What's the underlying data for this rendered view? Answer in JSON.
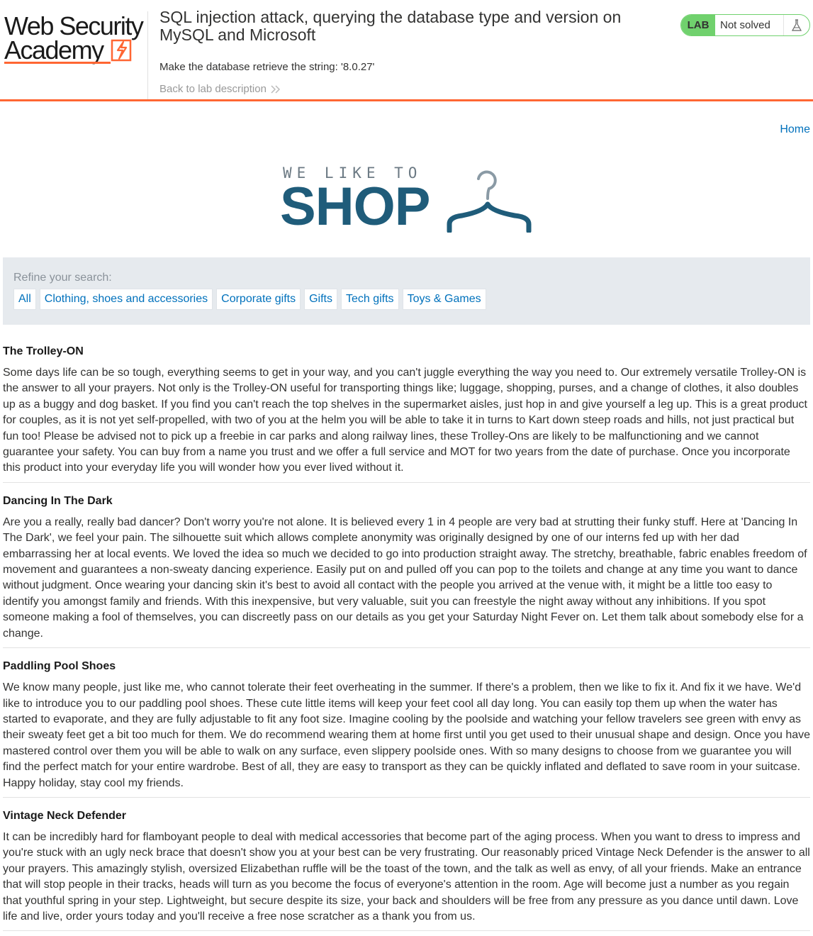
{
  "academy": {
    "logo_line1": "Web Security",
    "logo_line2": "Academy",
    "lab_title": "SQL injection attack, querying the database type and version on MySQL and Microsoft",
    "goal": "Make the database retrieve the string: '8.0.27'",
    "back_link": "Back to lab description",
    "lab_badge": "LAB",
    "lab_state": "Not solved",
    "accent_color": "#ff6633",
    "status_color": "#70d16d"
  },
  "shop": {
    "home_link": "Home",
    "logo_tagline": "WE LIKE TO",
    "logo_word": "SHOP",
    "brand_color": "#1f5c7a",
    "link_color": "#0071bc"
  },
  "filter": {
    "label": "Refine your search:",
    "categories": [
      "All",
      "Clothing, shoes and accessories",
      "Corporate gifts",
      "Gifts",
      "Tech gifts",
      "Toys & Games"
    ]
  },
  "products": [
    {
      "name": "The Trolley-ON",
      "description": "Some days life can be so tough, everything seems to get in your way, and you can't juggle everything the way you need to. Our extremely versatile Trolley-ON is the answer to all your prayers. Not only is the Trolley-ON useful for transporting things like; luggage, shopping, purses, and a change of clothes, it also doubles up as a buggy and dog basket. If you find you can't reach the top shelves in the supermarket aisles, just hop in and give yourself a leg up. This is a great product for couples, as it is not yet self-propelled, with two of you at the helm you will be able to take it in turns to Kart down steep roads and hills, not just practical but fun too! Please be advised not to pick up a freebie in car parks and along railway lines, these Trolley-Ons are likely to be malfunctioning and we cannot guarantee your safety. You can buy from a name you trust and we offer a full service and MOT for two years from the date of purchase. Once you incorporate this product into your everyday life you will wonder how you ever lived without it."
    },
    {
      "name": "Dancing In The Dark",
      "description": "Are you a really, really bad dancer? Don't worry you're not alone. It is believed every 1 in 4 people are very bad at strutting their funky stuff. Here at 'Dancing In The Dark', we feel your pain. The silhouette suit which allows complete anonymity was originally designed by one of our interns fed up with her dad embarrassing her at local events. We loved the idea so much we decided to go into production straight away. The stretchy, breathable, fabric enables freedom of movement and guarantees a non-sweaty dancing experience. Easily put on and pulled off you can pop to the toilets and change at any time you want to dance without judgment. Once wearing your dancing skin it's best to avoid all contact with the people you arrived at the venue with, it might be a little too easy to identify you amongst family and friends. With this inexpensive, but very valuable, suit you can freestyle the night away without any inhibitions. If you spot someone making a fool of themselves, you can discreetly pass on our details as you get your Saturday Night Fever on. Let them talk about somebody else for a change."
    },
    {
      "name": "Paddling Pool Shoes",
      "description": "We know many people, just like me, who cannot tolerate their feet overheating in the summer. If there's a problem, then we like to fix it. And fix it we have. We'd like to introduce you to our paddling pool shoes. These cute little items will keep your feet cool all day long. You can easily top them up when the water has started to evaporate, and they are fully adjustable to fit any foot size. Imagine cooling by the poolside and watching your fellow travelers see green with envy as their sweaty feet get a bit too much for them. We do recommend wearing them at home first until you get used to their unusual shape and design. Once you have mastered control over them you will be able to walk on any surface, even slippery poolside ones. With so many designs to choose from we guarantee you will find the perfect match for your entire wardrobe. Best of all, they are easy to transport as they can be quickly inflated and deflated to save room in your suitcase. Happy holiday, stay cool my friends."
    },
    {
      "name": "Vintage Neck Defender",
      "description": "It can be incredibly hard for flamboyant people to deal with medical accessories that become part of the aging process. When you want to dress to impress and you're stuck with an ugly neck brace that doesn't show you at your best can be very frustrating. Our reasonably priced Vintage Neck Defender is the answer to all your prayers. This amazingly stylish, oversized Elizabethan ruffle will be the toast of the town, and the talk as well as envy, of all your friends. Make an entrance that will stop people in their tracks, heads will turn as you become the focus of everyone's attention in the room. Age will become just a number as you regain that youthful spring in your step. Lightweight, but secure despite its size, your back and shoulders will be free from any pressure as you dance until dawn. Love life and live, order yours today and you'll receive a free nose scratcher as a thank you from us."
    }
  ],
  "icons": {
    "zap": "lightning-bolt-icon",
    "back": "double-chevron-right-icon",
    "lab": "flask-icon",
    "hanger": "coat-hanger-icon"
  }
}
